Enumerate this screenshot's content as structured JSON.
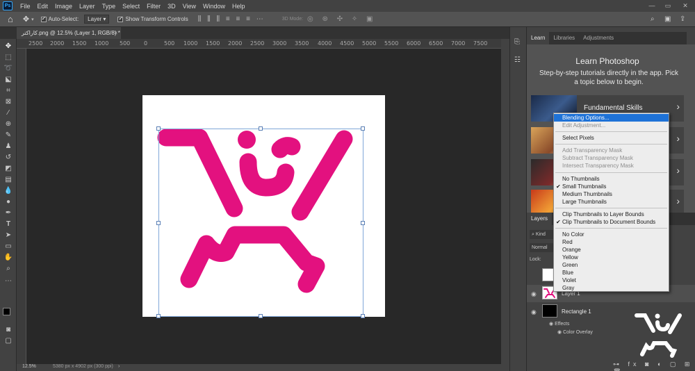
{
  "menubar": {
    "app_icon": "Ps",
    "items": [
      "File",
      "Edit",
      "Image",
      "Layer",
      "Type",
      "Select",
      "Filter",
      "3D",
      "View",
      "Window",
      "Help"
    ]
  },
  "options_bar": {
    "auto_select_label": "Auto-Select:",
    "auto_select_checked": true,
    "auto_select_value": "Layer",
    "show_transform_label": "Show Transform Controls",
    "show_transform_checked": true,
    "mode_3d_label": "3D Mode:"
  },
  "document_tab": {
    "title": "کاراکتر.png @ 12.5% (Layer 1, RGB/8) *",
    "close": "×"
  },
  "ruler": {
    "ticks": [
      "2500",
      "2000",
      "1500",
      "1000",
      "500",
      "0",
      "500",
      "1000",
      "1500",
      "2000",
      "2500",
      "3000",
      "3500",
      "4000",
      "4500",
      "5000",
      "5500",
      "6000",
      "6500",
      "7000",
      "7500"
    ]
  },
  "status_bar": {
    "zoom": "12.5%",
    "doc_info": "5380 px x 4902 px (300 ppi)"
  },
  "right_panel": {
    "tabs": [
      "Learn",
      "Libraries",
      "Adjustments"
    ],
    "active_tab": "Learn",
    "learn_title": "Learn Photoshop",
    "learn_desc": "Step-by-step tutorials directly in the app. Pick a topic below to begin.",
    "cards": [
      {
        "label": "Fundamental Skills"
      },
      {
        "label": ""
      },
      {
        "label": ""
      },
      {
        "label": ""
      }
    ]
  },
  "layers_panel": {
    "tab": "Layers",
    "kind_label": "Kind",
    "blend_mode": "Normal",
    "lock_label": "Lock:",
    "layers": [
      {
        "name": "Layer 1"
      },
      {
        "name": "Rectangle 1"
      }
    ],
    "effects_label": "Effects",
    "color_overlay_label": "Color Overlay"
  },
  "context_menu": {
    "groups": [
      [
        {
          "label": "Blending Options...",
          "state": "highlighted",
          "checked": false
        },
        {
          "label": "Edit Adjustment...",
          "state": "disabled",
          "checked": false
        }
      ],
      [
        {
          "label": "Select Pixels",
          "state": "normal",
          "checked": false
        }
      ],
      [
        {
          "label": "Add Transparency Mask",
          "state": "disabled",
          "checked": false
        },
        {
          "label": "Subtract Transparency Mask",
          "state": "disabled",
          "checked": false
        },
        {
          "label": "Intersect Transparency Mask",
          "state": "disabled",
          "checked": false
        }
      ],
      [
        {
          "label": "No Thumbnails",
          "state": "normal",
          "checked": false
        },
        {
          "label": "Small Thumbnails",
          "state": "normal",
          "checked": true
        },
        {
          "label": "Medium Thumbnails",
          "state": "normal",
          "checked": false
        },
        {
          "label": "Large Thumbnails",
          "state": "normal",
          "checked": false
        }
      ],
      [
        {
          "label": "Clip Thumbnails to Layer Bounds",
          "state": "normal",
          "checked": false
        },
        {
          "label": "Clip Thumbnails to Document Bounds",
          "state": "normal",
          "checked": true
        }
      ],
      [
        {
          "label": "No Color",
          "state": "normal",
          "checked": false
        },
        {
          "label": "Red",
          "state": "normal",
          "checked": false
        },
        {
          "label": "Orange",
          "state": "normal",
          "checked": false
        },
        {
          "label": "Yellow",
          "state": "normal",
          "checked": false
        },
        {
          "label": "Green",
          "state": "normal",
          "checked": false
        },
        {
          "label": "Blue",
          "state": "normal",
          "checked": false
        },
        {
          "label": "Violet",
          "state": "normal",
          "checked": false
        },
        {
          "label": "Gray",
          "state": "normal",
          "checked": false
        }
      ]
    ]
  },
  "colors": {
    "artwork_pink": "#e3117f",
    "menu_highlight": "#1e72d7",
    "ps_blue": "#31a8ff"
  }
}
